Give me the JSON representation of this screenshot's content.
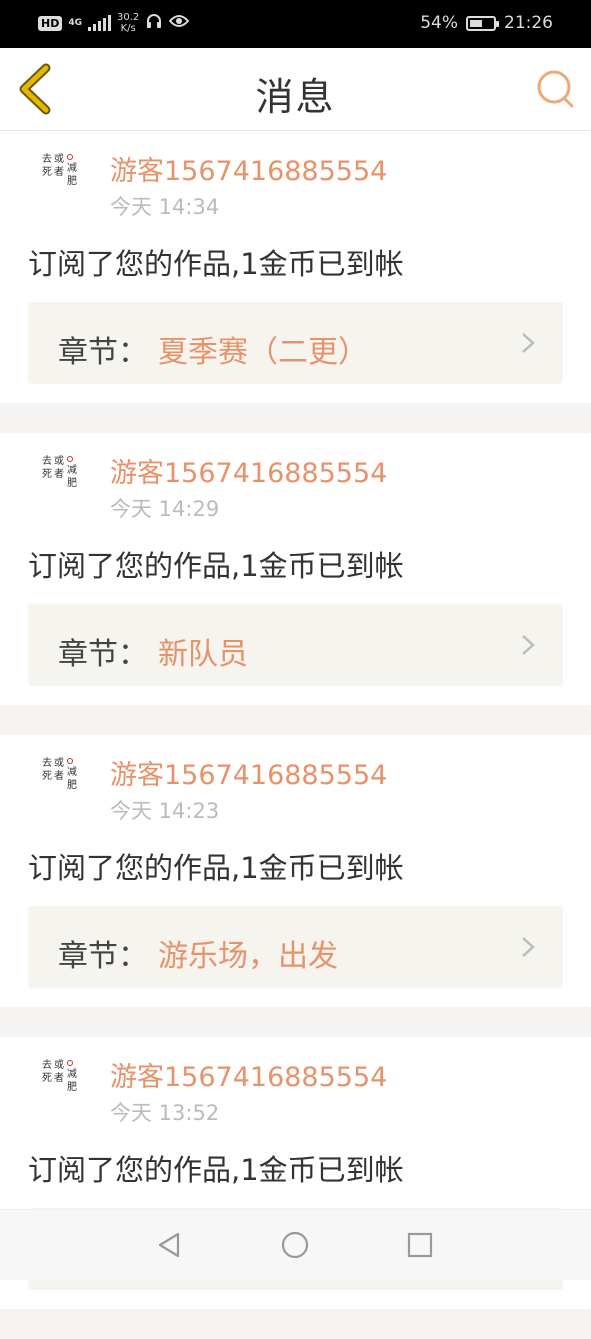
{
  "status_bar": {
    "hd": "HD",
    "network": "4G",
    "speed_value": "30.2",
    "speed_unit": "K/s",
    "battery_text": "54%",
    "battery_level": 0.54,
    "time": "21:26"
  },
  "header": {
    "title": "消息",
    "back_icon": "back-chevron-icon",
    "search_icon": "search-icon"
  },
  "avatar_text": {
    "line1": "减肥",
    "line2": "或者去死"
  },
  "messages": [
    {
      "user": "游客1567416885554",
      "time": "今天 14:34",
      "text": "订阅了您的作品,1金币已到帐",
      "chapter_label": "章节：",
      "chapter_name": "夏季赛（二更）"
    },
    {
      "user": "游客1567416885554",
      "time": "今天 14:29",
      "text": "订阅了您的作品,1金币已到帐",
      "chapter_label": "章节：",
      "chapter_name": "新队员"
    },
    {
      "user": "游客1567416885554",
      "time": "今天 14:23",
      "text": "订阅了您的作品,1金币已到帐",
      "chapter_label": "章节：",
      "chapter_name": "游乐场，出发"
    },
    {
      "user": "游客1567416885554",
      "time": "今天 13:52",
      "text": "订阅了您的作品,1金币已到帐",
      "chapter_label": "",
      "chapter_name": ""
    }
  ],
  "nav": {
    "back": "triangle-back-icon",
    "home": "circle-home-icon",
    "recents": "square-recents-icon"
  },
  "colors": {
    "accent": "#e8926a",
    "back_icon": "#e6b800"
  }
}
